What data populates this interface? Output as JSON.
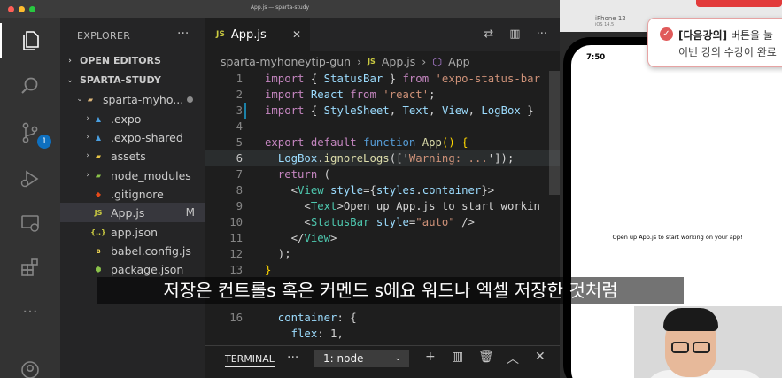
{
  "window": {
    "title": "App.js — sparta-study"
  },
  "sidebar": {
    "header": "EXPLORER",
    "open_editors": "OPEN EDITORS",
    "project": "SPARTA-STUDY",
    "folder": "sparta-myho...",
    "items": [
      {
        "label": ".expo"
      },
      {
        "label": ".expo-shared"
      },
      {
        "label": "assets"
      },
      {
        "label": "node_modules"
      },
      {
        "label": ".gitignore"
      },
      {
        "label": "App.js",
        "status": "M"
      },
      {
        "label": "app.json"
      },
      {
        "label": "babel.config.js"
      },
      {
        "label": "package.json"
      }
    ],
    "scm_badge": "1"
  },
  "editor": {
    "tab": "App.js",
    "breadcrumb": {
      "folder": "sparta-myhoneytip-gun",
      "file": "App.js",
      "symbol": "App"
    },
    "line_numbers": [
      "1",
      "2",
      "3",
      "4",
      "5",
      "6",
      "7",
      "8",
      "9",
      "10",
      "11",
      "12",
      "13",
      "",
      "",
      "16"
    ]
  },
  "terminal": {
    "tab": "TERMINAL",
    "selected": "1: node"
  },
  "simulator": {
    "device": "iPhone 12",
    "ios": "iOS 14.5",
    "time": "7:50",
    "app_text": "Open up App.js to start working on your app!"
  },
  "notification": {
    "title_bold": "[다음강의]",
    "title_rest": "버튼을 눌",
    "body": "이번 강의 수강이 완료"
  },
  "subtitle": "저장은 컨트롤s 혹은 커멘드 s에요 워드나 엑셀 저장한 것처럼"
}
